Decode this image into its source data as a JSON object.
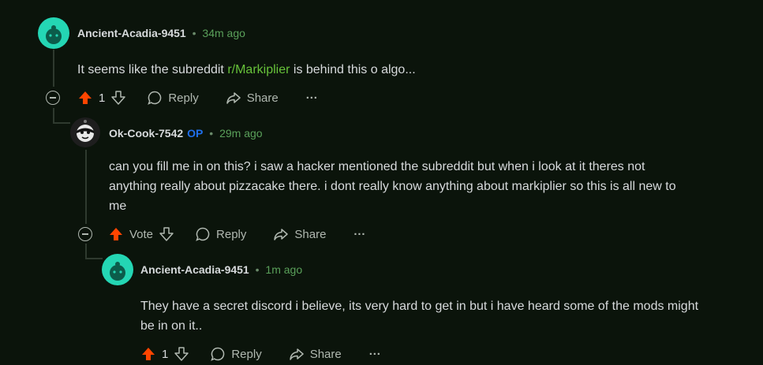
{
  "comments": [
    {
      "username": "Ancient-Acadia-9451",
      "op": "",
      "separator": "•",
      "time": "34m ago",
      "body_before_link": "It seems like the subreddit ",
      "body_link": "r/Markiplier",
      "body_after_link": " is behind this o algo...",
      "votes": "1",
      "reply_label": "Reply",
      "share_label": "Share",
      "more_label": "···",
      "avatar": "snoo-avatar",
      "upvoted": true
    },
    {
      "username": "Ok-Cook-7542",
      "op": "OP",
      "separator": "•",
      "time": "29m ago",
      "body_lines": [
        "can you fill me in on this? i saw a hacker mentioned the subreddit but when i look at it theres not",
        "anything really about pizzacake there. i dont really know anything about markiplier so this is all new to",
        "me"
      ],
      "votes": "Vote",
      "reply_label": "Reply",
      "share_label": "Share",
      "more_label": "···",
      "avatar": "masked-avatar",
      "upvoted": true
    },
    {
      "username": "Ancient-Acadia-9451",
      "op": "",
      "separator": "•",
      "time": "1m ago",
      "body_lines": [
        "They have a secret discord i believe, its very hard to get in but i have heard some of the mods might",
        "be in on it.."
      ],
      "votes": "1",
      "reply_label": "Reply",
      "share_label": "Share",
      "more_label": "···",
      "avatar": "snoo-avatar",
      "upvoted": true
    }
  ],
  "colors": {
    "upvote": "#ff4500",
    "link": "#67c23a",
    "time": "#5aa05a",
    "op": "#1f6feb",
    "avatar_teal": "#24d6b4"
  }
}
